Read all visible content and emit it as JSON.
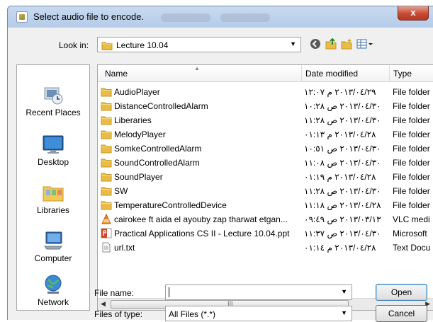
{
  "window": {
    "title": "Select audio file to encode.",
    "close_label": "x"
  },
  "lookin": {
    "label": "Look in:",
    "value": "Lecture 10.04"
  },
  "places": [
    {
      "label": "Recent Places",
      "icon": "recent-places-icon"
    },
    {
      "label": "Desktop",
      "icon": "desktop-icon"
    },
    {
      "label": "Libraries",
      "icon": "libraries-icon"
    },
    {
      "label": "Computer",
      "icon": "computer-icon"
    },
    {
      "label": "Network",
      "icon": "network-icon"
    }
  ],
  "columns": {
    "name": "Name",
    "date": "Date modified",
    "type": "Type"
  },
  "files": [
    {
      "name": "AudioPlayer",
      "date": "٢٠١٣/٠٤/٢٩ م ١٢:٠٧",
      "type": "File folder",
      "icon": "folder"
    },
    {
      "name": "DistanceControlledAlarm",
      "date": "٢٠١٣/٠٤/٣٠ ص ١٠:٢٨",
      "type": "File folder",
      "icon": "folder"
    },
    {
      "name": "Liberaries",
      "date": "٢٠١٣/٠٤/٣٠ ص ١١:٢٨",
      "type": "File folder",
      "icon": "folder"
    },
    {
      "name": "MelodyPlayer",
      "date": "٢٠١٣/٠٤/٢٨ م ٠١:١٣",
      "type": "File folder",
      "icon": "folder"
    },
    {
      "name": "SomkeControlledAlarm",
      "date": "٢٠١٣/٠٤/٣٠ ص ١٠:٥١",
      "type": "File folder",
      "icon": "folder"
    },
    {
      "name": "SoundControlledAlarm",
      "date": "٢٠١٣/٠٤/٣٠ ص ١١:٠٨",
      "type": "File folder",
      "icon": "folder"
    },
    {
      "name": "SoundPlayer",
      "date": "٢٠١٣/٠٤/٢٨ م ٠١:١٩",
      "type": "File folder",
      "icon": "folder"
    },
    {
      "name": "SW",
      "date": "٢٠١٣/٠٤/٣٠ ص ١١:٢٨",
      "type": "File folder",
      "icon": "folder"
    },
    {
      "name": "TemperatureControlledDevice",
      "date": "٢٠١٣/٠٤/٢٨ ص ١١:١٨",
      "type": "File folder",
      "icon": "folder"
    },
    {
      "name": "cairokee ft aida el ayouby zap tharwat etgan...",
      "date": "٢٠١٣/٠٣/١٣ ص ٠٩:٤٩",
      "type": "VLC medi",
      "icon": "vlc"
    },
    {
      "name": "Practical Applications CS II - Lecture 10.04.ppt",
      "date": "٢٠١٣/٠٤/٣٠ ص ١١:٣٧",
      "type": "Microsoft",
      "icon": "ppt"
    },
    {
      "name": "url.txt",
      "date": "٢٠١٣/٠٤/٢٨ م ٠١:١٤",
      "type": "Text Docu",
      "icon": "txt"
    }
  ],
  "filename": {
    "label": "File name:",
    "value": ""
  },
  "filetype": {
    "label": "Files of type:",
    "value": "All Files (*.*)"
  },
  "buttons": {
    "open": "Open",
    "cancel": "Cancel"
  },
  "scroll": {
    "grip": "III"
  }
}
